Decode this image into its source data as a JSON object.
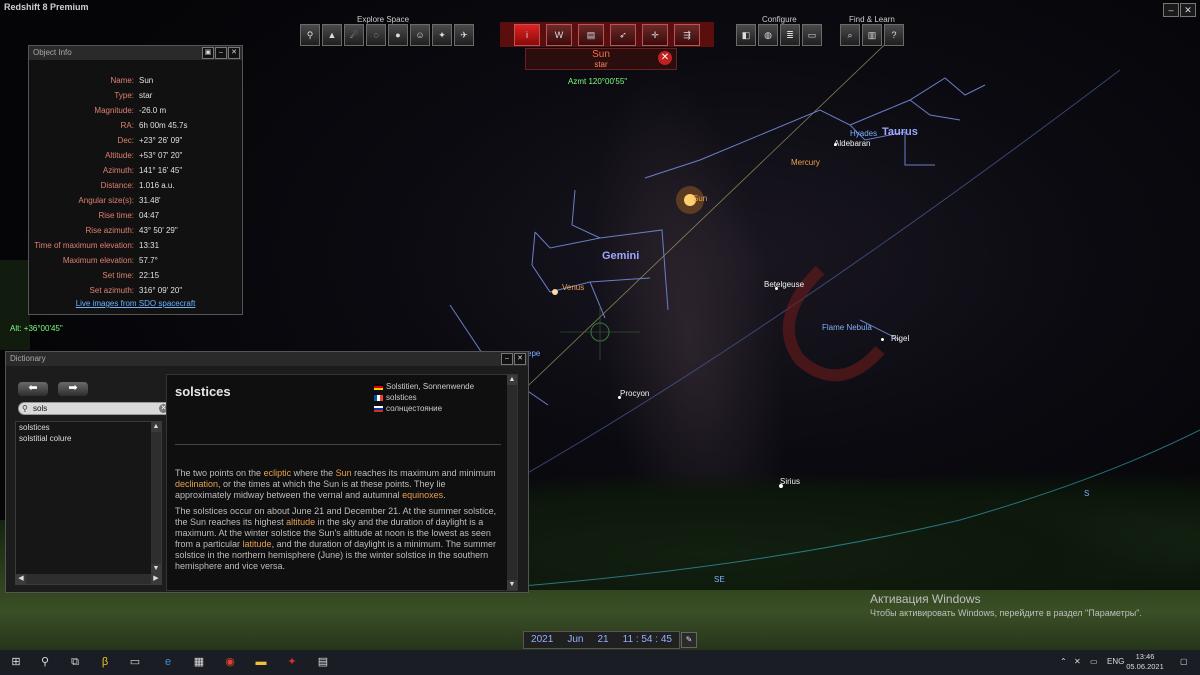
{
  "app": {
    "title": "Redshift 8 Premium"
  },
  "toolbar": {
    "explore_label": "Explore Space",
    "configure_label": "Configure",
    "find_label": "Find & Learn",
    "info_icon_label": "i",
    "wiki_icon_label": "W",
    "help_icon_label": "?"
  },
  "selected": {
    "name": "Sun",
    "type": "star",
    "azimuth_readout": "Azmt 120°00'55\""
  },
  "altitude_readout": "Alt: +36°00'45\"",
  "object_info": {
    "title": "Object Info",
    "rows": [
      {
        "key": "Name:",
        "value": "Sun"
      },
      {
        "key": "Type:",
        "value": "star"
      },
      {
        "key": "Magnitude:",
        "value": "-26.0 m"
      },
      {
        "key": "RA:",
        "value": "6h 00m 45.7s"
      },
      {
        "key": "Dec:",
        "value": "+23° 26' 09\""
      },
      {
        "key": "Altitude:",
        "value": "+53° 07' 20\""
      },
      {
        "key": "Azimuth:",
        "value": "141° 16' 45\""
      },
      {
        "key": "Distance:",
        "value": "1.016 a.u."
      },
      {
        "key": "Angular size(s):",
        "value": "31.48'"
      },
      {
        "key": "Rise time:",
        "value": "04:47"
      },
      {
        "key": "Rise azimuth:",
        "value": "43° 50' 29\""
      },
      {
        "key": "Time of maximum elevation:",
        "value": "13:31"
      },
      {
        "key": "Maximum elevation:",
        "value": "57.7°"
      },
      {
        "key": "Set time:",
        "value": "22:15"
      },
      {
        "key": "Set azimuth:",
        "value": "316° 09' 20\""
      }
    ],
    "link": "Live images from SDO spacecraft"
  },
  "sky_labels": {
    "taurus": "Taurus",
    "hyades": "Hyades",
    "aldebaran": "Aldebaran",
    "mercury": "Mercury",
    "sun": "Sun",
    "gemini": "Gemini",
    "venus": "Venus",
    "betelgeuse": "Betelgeuse",
    "flame_nebula": "Flame Nebula",
    "rigel": "Rigel",
    "procyon": "Procyon",
    "sirius": "Sirius",
    "epe": "epe",
    "s": "S",
    "se": "SE"
  },
  "dictionary": {
    "title": "Dictionary",
    "search_value": "sols",
    "results": [
      "solstices",
      "solstitial colure"
    ],
    "article_title": "solstices",
    "translations": [
      "Solstitien, Sonnenwende",
      "solstices",
      "солнцестояние"
    ],
    "p1": {
      "a": "The two points on the ",
      "b": "ecliptic",
      "c": " where the ",
      "d": "Sun",
      "e": " reaches its maximum and minimum ",
      "f": "declination",
      "g": ", or the times at which the Sun is at these points. They lie approximately midway between the vernal and autumnal ",
      "h": "equinoxes",
      "i": "."
    },
    "p2": {
      "a": "The solstices occur on about June 21 and December 21. At the summer solstice, the Sun reaches its highest ",
      "b": "altitude",
      "c": " in the sky and the duration of daylight is a maximum. At the winter solstice the Sun's altitude at noon is the lowest as seen from a particular ",
      "d": "latitude",
      "e": ", and the duration of daylight is a minimum. The summer solstice in the northern hemisphere (June) is the winter solstice in the southern hemisphere and vice versa."
    }
  },
  "datetime": {
    "year": "2021",
    "month": "Jun",
    "day": "21",
    "time": "11 : 54 : 45"
  },
  "watermark": {
    "line1": "Активация Windows",
    "line2": "Чтобы активировать Windows, перейдите в раздел \"Параметры\"."
  },
  "taskbar": {
    "lang": "ENG",
    "time": "13:46",
    "date": "05.06.2021"
  }
}
